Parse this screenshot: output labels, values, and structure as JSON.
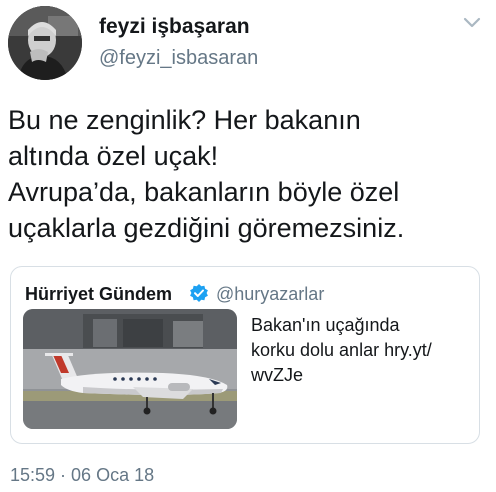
{
  "author": {
    "display_name": "feyzi işbaşaran",
    "handle": "@feyzi_isbasaran"
  },
  "tweet": {
    "lines": [
      "Bu ne zenginlik? Her bakanın",
      "altında özel uçak!",
      "Avrupa’da, bakanların böyle özel",
      "uçaklarla gezdiğini göremezsiniz."
    ],
    "timestamp": "15:59 · 06 Oca 18"
  },
  "quoted": {
    "display_name": "Hürriyet Gündem",
    "handle": "@huryazarlar",
    "text_lines": [
      "Bakan'ın uçağında",
      "korku dolu anlar hry.yt/",
      "wvZJe"
    ],
    "media_alt": "white private jet on tarmac",
    "verified_icon": "verified-badge-icon"
  },
  "colors": {
    "primary_text": "#14171a",
    "secondary_text": "#657786",
    "verified_blue": "#1da1f2",
    "card_border": "#d8dfe5"
  }
}
